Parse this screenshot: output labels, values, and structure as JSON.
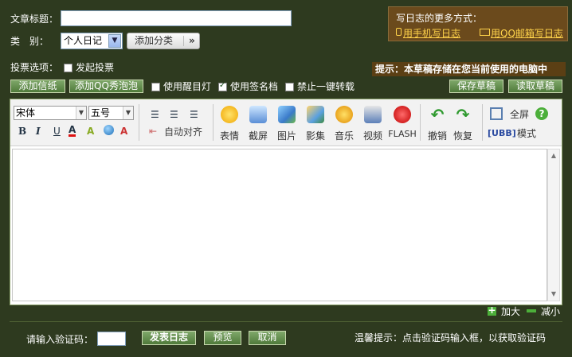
{
  "form": {
    "title_label": "文章标题：",
    "category_label": "类　别：",
    "category_value": "个人日记",
    "add_category_label": "添加分类",
    "add_category_chevron": "»",
    "vote_label": "投票选项：",
    "vote_checkbox_label": "发起投票"
  },
  "more_ways": {
    "title": "写日志的更多方式：",
    "mobile_link": "用手机写日志",
    "qqmail_link": "用QQ邮箱写日志"
  },
  "draft_tip": "提示：本草稿存储在您当前使用的电脑中",
  "actions": {
    "add_paper": "添加信纸",
    "add_qq_bubble": "添加QQ秀泡泡",
    "use_highlight": "使用醒目灯",
    "use_signature": "使用签名档",
    "forbid_repost": "禁止一键转载",
    "save_draft": "保存草稿",
    "read_draft": "读取草稿"
  },
  "checkbox_state": {
    "use_highlight": false,
    "use_signature": true,
    "forbid_repost": false
  },
  "toolbar": {
    "font_value": "宋体",
    "size_value": "五号",
    "bold": "B",
    "italic": "I",
    "underline": "U",
    "font_color": "A",
    "auto_align": "自动对齐",
    "emotion": "表情",
    "screenshot": "截屏",
    "picture": "图片",
    "album": "影集",
    "music": "音乐",
    "video": "视频",
    "flash": "FLASH",
    "undo": "撤销",
    "redo": "恢复",
    "fullscreen": "全屏",
    "ubb": "[UBB]",
    "mode": "模式",
    "help": "?"
  },
  "resize": {
    "enlarge": "加大",
    "shrink": "减小"
  },
  "bottom": {
    "captcha_label": "请输入验证码：",
    "publish": "发表日志",
    "preview": "预览",
    "cancel": "取消",
    "hint": "温馨提示：点击验证码输入框，以获取验证码"
  },
  "colors": {
    "background": "#2e3a1f",
    "button_green": "#5f8a48",
    "tip_brown": "#5b3f14",
    "link_yellow": "#ffd34a"
  }
}
